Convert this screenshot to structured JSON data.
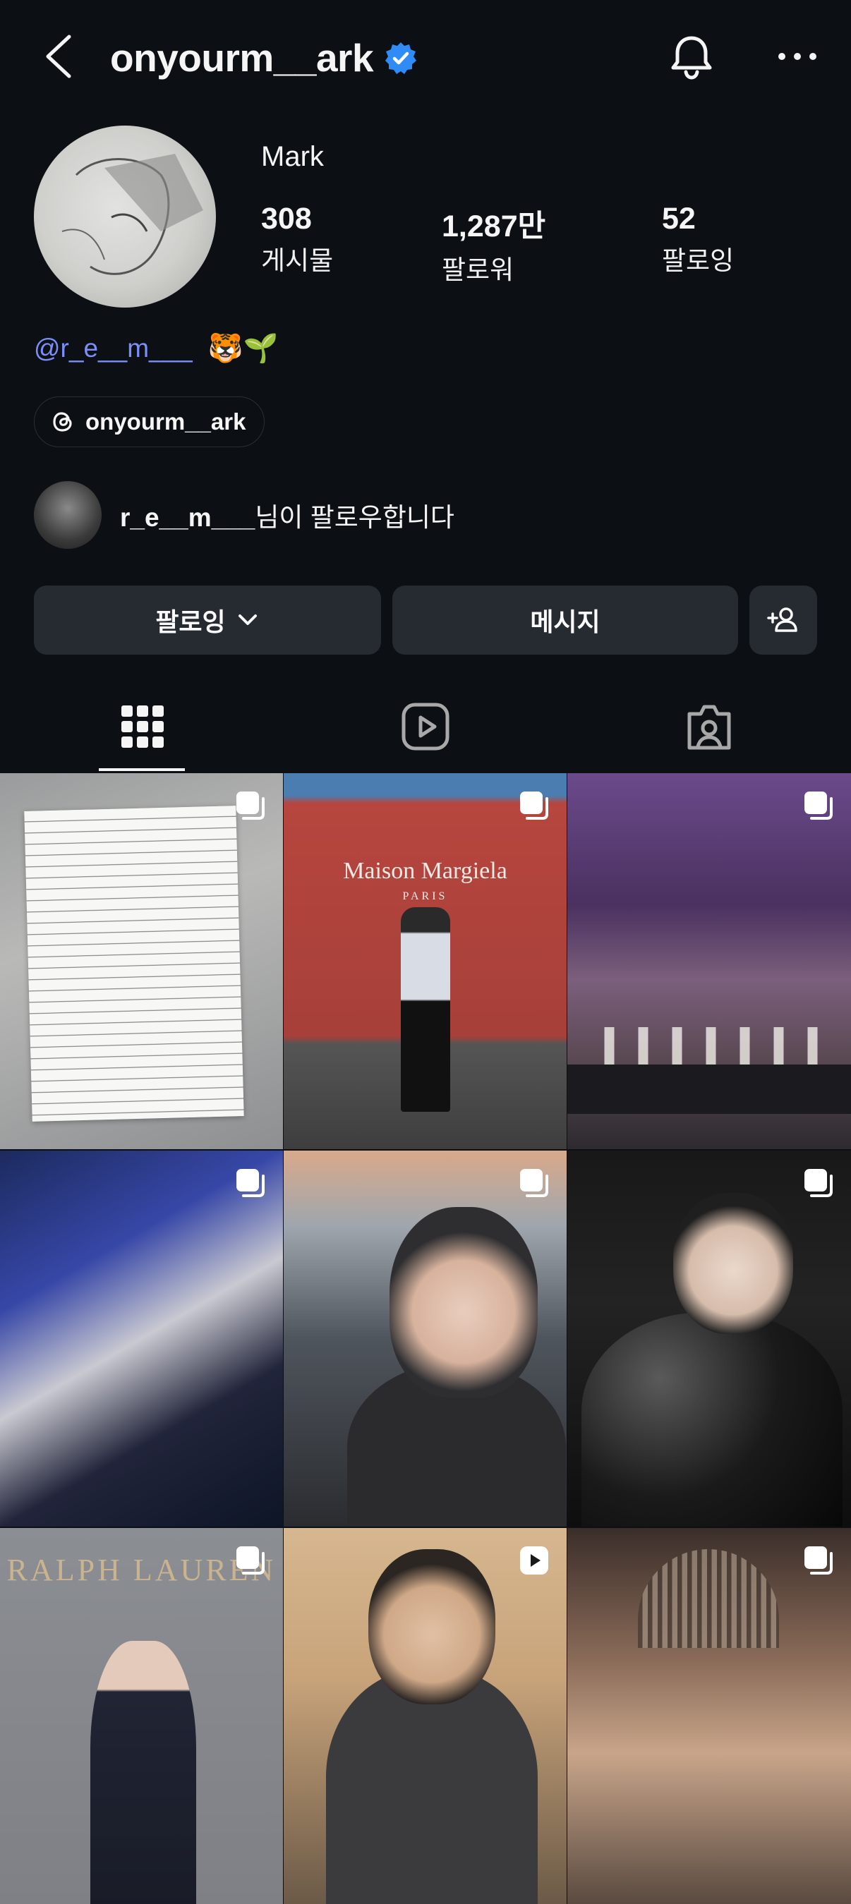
{
  "header": {
    "username": "onyourm__ark",
    "verified": true
  },
  "profile": {
    "name": "Mark",
    "stats": [
      {
        "value": "308",
        "label": "게시물"
      },
      {
        "value": "1,287만",
        "label": "팔로워"
      },
      {
        "value": "52",
        "label": "팔로잉"
      }
    ],
    "bio_mention": "@r_e__m___",
    "bio_emoji": "🐯🌱",
    "threads_handle": "onyourm__ark",
    "mutual": {
      "username": "r_e__m___",
      "suffix": "님이 팔로우합니다"
    }
  },
  "actions": {
    "following_label": "팔로잉",
    "message_label": "메시지"
  },
  "tabs": [
    "grid-icon",
    "reels-icon",
    "tagged-icon"
  ],
  "grid": [
    {
      "type": "carousel",
      "overlay": ""
    },
    {
      "type": "carousel",
      "overlay": "Maison Margiela",
      "overlay_sub": "PARIS"
    },
    {
      "type": "carousel",
      "overlay": ""
    },
    {
      "type": "carousel",
      "overlay": ""
    },
    {
      "type": "carousel",
      "overlay": ""
    },
    {
      "type": "carousel",
      "overlay": ""
    },
    {
      "type": "carousel",
      "overlay": "RALPH LAUREN"
    },
    {
      "type": "reel",
      "overlay": ""
    },
    {
      "type": "carousel",
      "overlay": ""
    }
  ],
  "colors": {
    "background": "#0c1014",
    "button": "#262b31",
    "mention": "#7c8ff8",
    "verified": "#2f8cf7"
  }
}
